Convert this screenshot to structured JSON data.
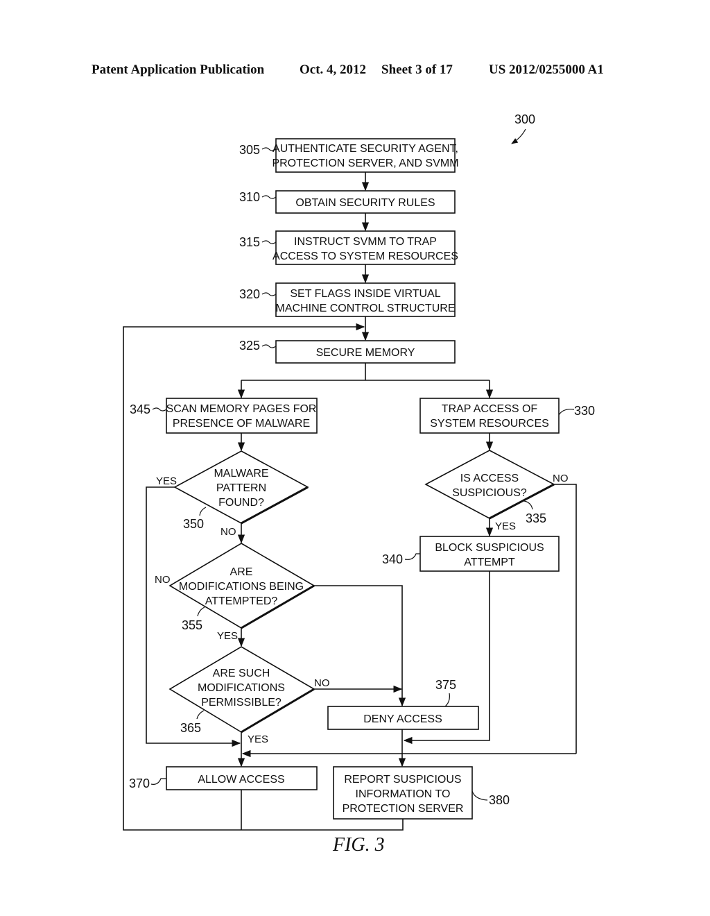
{
  "header": {
    "publication": "Patent Application Publication",
    "date": "Oct. 4, 2012",
    "sheet": "Sheet 3 of 17",
    "number": "US 2012/0255000 A1"
  },
  "figure": {
    "ref": "300",
    "caption": "FIG. 3"
  },
  "steps": {
    "s305": {
      "ref": "305",
      "lines": [
        "AUTHENTICATE SECURITY AGENT,",
        "PROTECTION SERVER, AND SVMM"
      ]
    },
    "s310": {
      "ref": "310",
      "lines": [
        "OBTAIN SECURITY RULES"
      ]
    },
    "s315": {
      "ref": "315",
      "lines": [
        "INSTRUCT SVMM TO TRAP",
        "ACCESS TO SYSTEM RESOURCES"
      ]
    },
    "s320": {
      "ref": "320",
      "lines": [
        "SET FLAGS INSIDE VIRTUAL",
        "MACHINE CONTROL STRUCTURE"
      ]
    },
    "s325": {
      "ref": "325",
      "lines": [
        "SECURE MEMORY"
      ]
    },
    "s330": {
      "ref": "330",
      "lines": [
        "TRAP ACCESS OF",
        "SYSTEM RESOURCES"
      ]
    },
    "s335": {
      "ref": "335",
      "lines": [
        "IS ACCESS",
        "SUSPICIOUS?"
      ]
    },
    "s340": {
      "ref": "340",
      "lines": [
        "BLOCK SUSPICIOUS",
        "ATTEMPT"
      ]
    },
    "s345": {
      "ref": "345",
      "lines": [
        "SCAN MEMORY PAGES FOR",
        "PRESENCE OF MALWARE"
      ]
    },
    "s350": {
      "ref": "350",
      "lines": [
        "MALWARE",
        "PATTERN",
        "FOUND?"
      ]
    },
    "s355": {
      "ref": "355",
      "lines": [
        "ARE",
        "MODIFICATIONS BEING",
        "ATTEMPTED?"
      ]
    },
    "s365": {
      "ref": "365",
      "lines": [
        "ARE SUCH",
        "MODIFICATIONS",
        "PERMISSIBLE?"
      ]
    },
    "s370": {
      "ref": "370",
      "lines": [
        "ALLOW ACCESS"
      ]
    },
    "s375": {
      "ref": "375",
      "lines": [
        "DENY ACCESS"
      ]
    },
    "s380": {
      "ref": "380",
      "lines": [
        "REPORT SUSPICIOUS",
        "INFORMATION TO",
        "PROTECTION SERVER"
      ]
    }
  },
  "branches": {
    "yes": "YES",
    "no": "NO"
  }
}
